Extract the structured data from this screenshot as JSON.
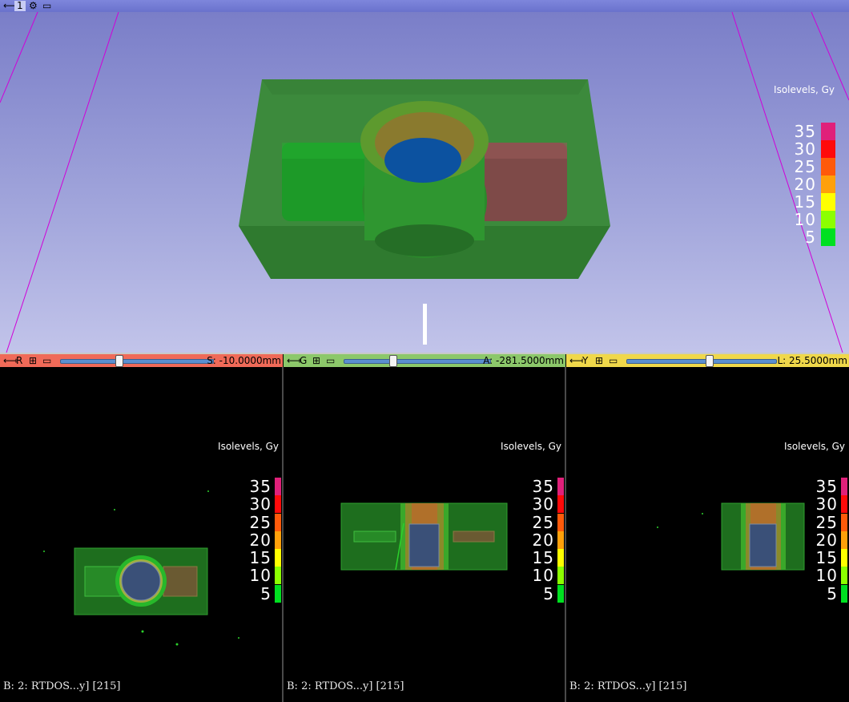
{
  "view3d": {
    "layout_number": "1",
    "isolevels_title": "Isolevels, Gy"
  },
  "colorscale": [
    {
      "label": "35",
      "color": "#e0207a"
    },
    {
      "label": "30",
      "color": "#ff0a0a"
    },
    {
      "label": "25",
      "color": "#ff5a0a"
    },
    {
      "label": "20",
      "color": "#ffa00a"
    },
    {
      "label": "15",
      "color": "#ffff00"
    },
    {
      "label": "10",
      "color": "#8cff00"
    },
    {
      "label": "5",
      "color": "#00e020"
    }
  ],
  "slice_red": {
    "letter": "R",
    "offset": "S: -10.0000mm",
    "slider_fraction": 0.38,
    "color": "#f06a58",
    "footer": "B: 2: RTDOS...y]  [215]",
    "isolevels_title": "Isolevels, Gy"
  },
  "slice_green": {
    "letter": "G",
    "offset": "A: -281.5000mm",
    "slider_fraction": 0.33,
    "color": "#8cc86a",
    "footer": "B: 2: RTDOS...y]  [215]",
    "isolevels_title": "Isolevels, Gy"
  },
  "slice_yellow": {
    "letter": "Y",
    "offset": "L: 25.5000mm",
    "slider_fraction": 0.55,
    "color": "#f0d84a",
    "footer": "B: 2: RTDOS...y]  [215]",
    "isolevels_title": "Isolevels, Gy"
  }
}
